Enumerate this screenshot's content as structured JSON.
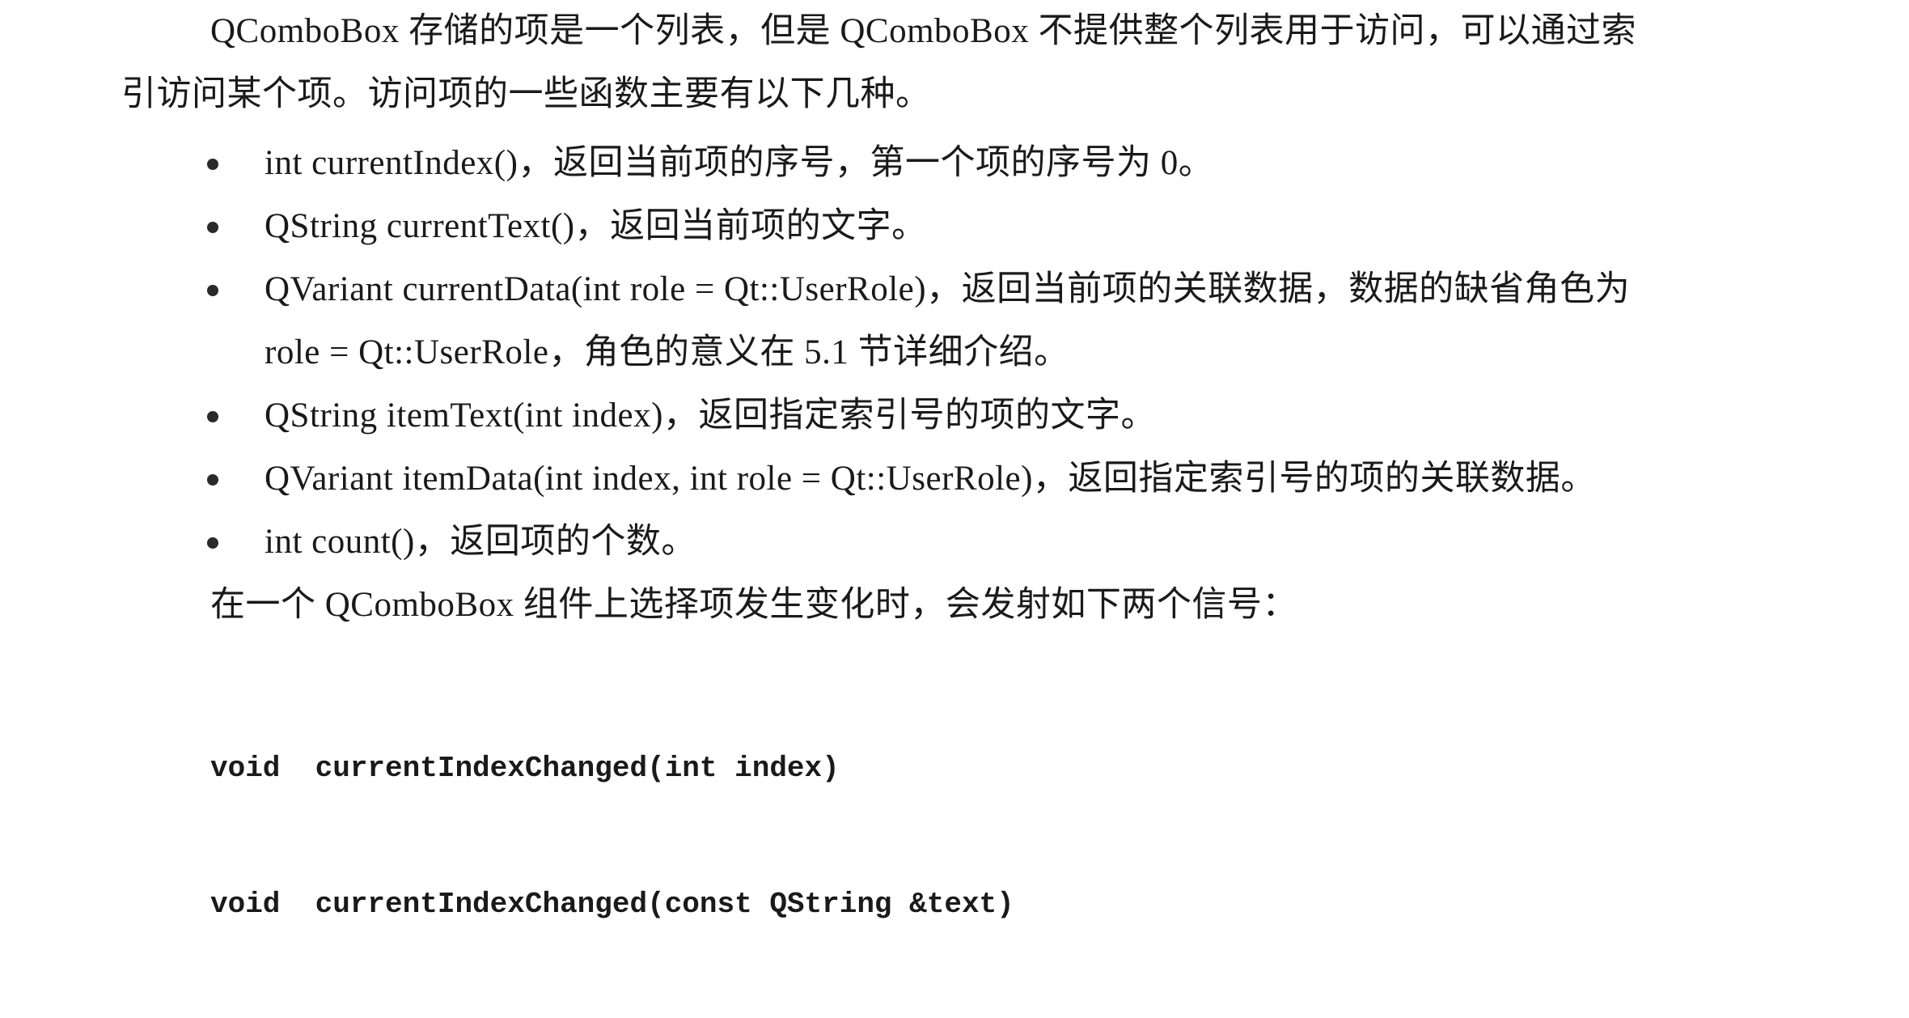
{
  "intro": {
    "line1": "QComboBox 存储的项是一个列表，但是 QComboBox 不提供整个列表用于访问，可以通过索",
    "line2": "引访问某个项。访问项的一些函数主要有以下几种。"
  },
  "bullets": [
    {
      "text": "int currentIndex()，返回当前项的序号，第一个项的序号为 0。",
      "cont": ""
    },
    {
      "text": "QString currentText()，返回当前项的文字。",
      "cont": ""
    },
    {
      "text": "QVariant currentData(int role = Qt::UserRole)，返回当前项的关联数据，数据的缺省角色为",
      "cont": "role = Qt::UserRole，角色的意义在 5.1 节详细介绍。"
    },
    {
      "text": "QString itemText(int index)，返回指定索引号的项的文字。",
      "cont": ""
    },
    {
      "text": "QVariant itemData(int index, int role = Qt::UserRole)，返回指定索引号的项的关联数据。",
      "cont": ""
    },
    {
      "text": "int count()，返回项的个数。",
      "cont": ""
    }
  ],
  "signal_intro": "在一个 QComboBox 组件上选择项发生变化时，会发射如下两个信号：",
  "code_lines": [
    "void  currentIndexChanged(int index)",
    "void  currentIndexChanged(const QString &text)"
  ]
}
